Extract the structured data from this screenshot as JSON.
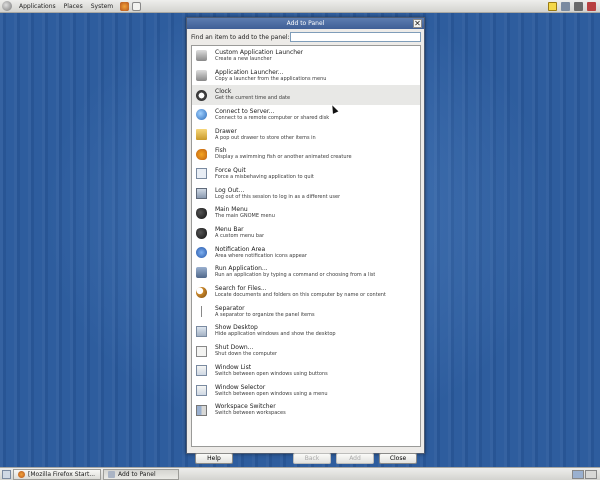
{
  "top_panel": {
    "menus": [
      "Applications",
      "Places",
      "System"
    ]
  },
  "dialog": {
    "title": "Add to Panel",
    "close_glyph": "✕",
    "search_label": "Find an item to add to the panel:",
    "search_value": "",
    "items": [
      {
        "name": "Custom Application Launcher",
        "desc": "Create a new launcher",
        "icon": "launcher-icon"
      },
      {
        "name": "Application Launcher...",
        "desc": "Copy a launcher from the applications menu",
        "icon": "app-launcher-icon"
      },
      {
        "name": "Clock",
        "desc": "Get the current time and date",
        "icon": "clock-icon"
      },
      {
        "name": "Connect to Server...",
        "desc": "Connect to a remote computer or shared disk",
        "icon": "globe-icon"
      },
      {
        "name": "Drawer",
        "desc": "A pop out drawer to store other items in",
        "icon": "drawer-icon"
      },
      {
        "name": "Fish",
        "desc": "Display a swimming fish or another animated creature",
        "icon": "fish-icon"
      },
      {
        "name": "Force Quit",
        "desc": "Force a misbehaving application to quit",
        "icon": "force-quit-icon"
      },
      {
        "name": "Log Out...",
        "desc": "Log out of this session to log in as a different user",
        "icon": "logout-icon"
      },
      {
        "name": "Main Menu",
        "desc": "The main GNOME menu",
        "icon": "gnome-foot-icon"
      },
      {
        "name": "Menu Bar",
        "desc": "A custom menu bar",
        "icon": "gnome-foot-icon"
      },
      {
        "name": "Notification Area",
        "desc": "Area where notification icons appear",
        "icon": "info-icon"
      },
      {
        "name": "Run Application...",
        "desc": "Run an application by typing a command or choosing from a list",
        "icon": "run-icon"
      },
      {
        "name": "Search for Files...",
        "desc": "Locate documents and folders on this computer by name or content",
        "icon": "magnifier-icon"
      },
      {
        "name": "Separator",
        "desc": "A separator to organize the panel items",
        "icon": "separator-icon"
      },
      {
        "name": "Show Desktop",
        "desc": "Hide application windows and show the desktop",
        "icon": "desktop-icon"
      },
      {
        "name": "Shut Down...",
        "desc": "Shut down the computer",
        "icon": "shutdown-icon"
      },
      {
        "name": "Window List",
        "desc": "Switch between open windows using buttons",
        "icon": "window-list-icon"
      },
      {
        "name": "Window Selector",
        "desc": "Switch between open windows using a menu",
        "icon": "window-selector-icon"
      },
      {
        "name": "Workspace Switcher",
        "desc": "Switch between workspaces",
        "icon": "workspace-icon"
      }
    ],
    "buttons": {
      "help": "Help",
      "back": "Back",
      "add": "Add",
      "close": "Close"
    }
  },
  "bottom_panel": {
    "tasks": [
      "[Mozilla Firefox Start...",
      "Add to Panel"
    ]
  },
  "colors": {
    "desktop": "#2a5a9c",
    "titlebar": "#4a6aa2",
    "panel": "#e3e3e0"
  }
}
